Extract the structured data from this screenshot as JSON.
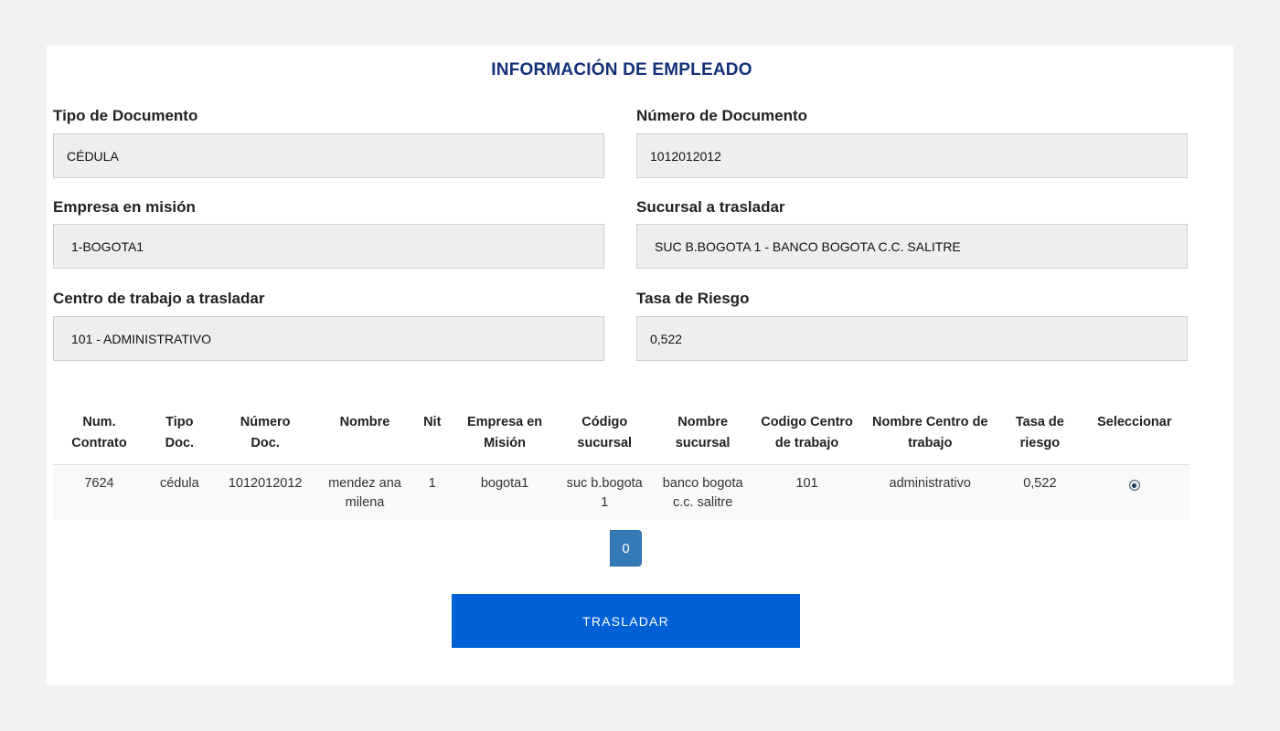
{
  "form": {
    "title": "INFORMACIÓN DE EMPLEADO",
    "fields": {
      "tipo_documento": {
        "label": "Tipo de Documento",
        "value": "CÉDULA"
      },
      "numero_documento": {
        "label": "Número de Documento",
        "value": "1012012012"
      },
      "empresa_mision": {
        "label": "Empresa en misión",
        "value": "1-BOGOTA1"
      },
      "sucursal": {
        "label": "Sucursal a trasladar",
        "value": "SUC B.BOGOTA 1 - BANCO BOGOTA C.C. SALITRE"
      },
      "centro_trabajo": {
        "label": "Centro de trabajo a trasladar",
        "value": "101 - ADMINISTRATIVO"
      },
      "tasa_riesgo": {
        "label": "Tasa de Riesgo",
        "value": "0,522"
      }
    }
  },
  "table": {
    "headers": [
      [
        "Num.",
        "Contrato"
      ],
      [
        "Tipo",
        "Doc."
      ],
      [
        "Número",
        "Doc."
      ],
      [
        "Nombre"
      ],
      [
        "Nit"
      ],
      [
        "Empresa en",
        "Misión"
      ],
      [
        "Código",
        "sucursal"
      ],
      [
        "Nombre",
        "sucursal"
      ],
      [
        "Codigo Centro",
        "de trabajo"
      ],
      [
        "Nombre Centro de",
        "trabajo"
      ],
      [
        "Tasa de",
        "riesgo"
      ],
      [
        "Seleccionar"
      ]
    ],
    "rows": [
      {
        "cells": [
          [
            "7624"
          ],
          [
            "cédula"
          ],
          [
            "1012012012"
          ],
          [
            "mendez ana",
            "milena"
          ],
          [
            "1"
          ],
          [
            "bogota1"
          ],
          [
            "suc b.bogota",
            "1"
          ],
          [
            "banco bogota",
            "c.c. salitre"
          ],
          [
            "101"
          ],
          [
            "administrativo"
          ],
          [
            "0,522"
          ]
        ],
        "selected": true
      }
    ]
  },
  "pagination": {
    "current": "0"
  },
  "actions": {
    "submit_label": "TRASLADAR"
  },
  "colors": {
    "title": "#14307a",
    "primary": "#0060d6",
    "page": "#337ab7"
  }
}
